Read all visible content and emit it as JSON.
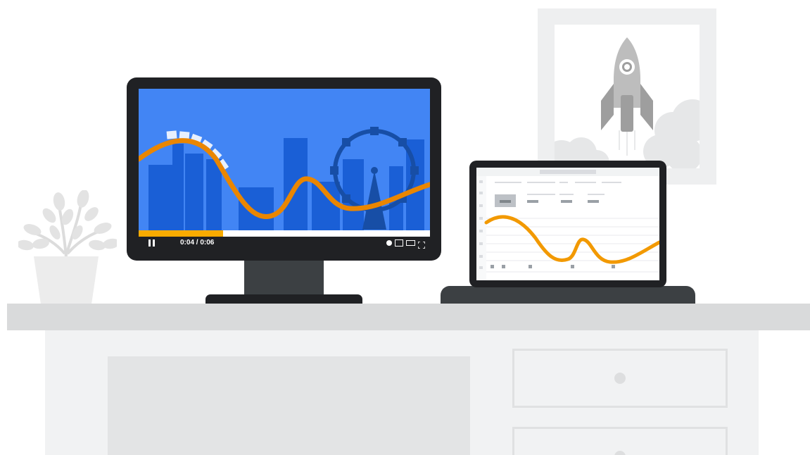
{
  "video_player": {
    "time_display": "0:04 / 0:06",
    "progress_fraction": 0.29,
    "accent_color": "#f9ab00",
    "screen_color": "#4285f4",
    "icons": {
      "play_pause": "pause-icon",
      "volume": "dot-icon",
      "small_player": "small-player-icon",
      "theater_mode": "theater-mode-icon",
      "fullscreen": "fullscreen-icon"
    }
  },
  "laptop_screen": {
    "line_color": "#f29900"
  },
  "colors": {
    "curve_orange": "#ea8600",
    "bezel": "#202124",
    "desk": "#d9dadb"
  }
}
